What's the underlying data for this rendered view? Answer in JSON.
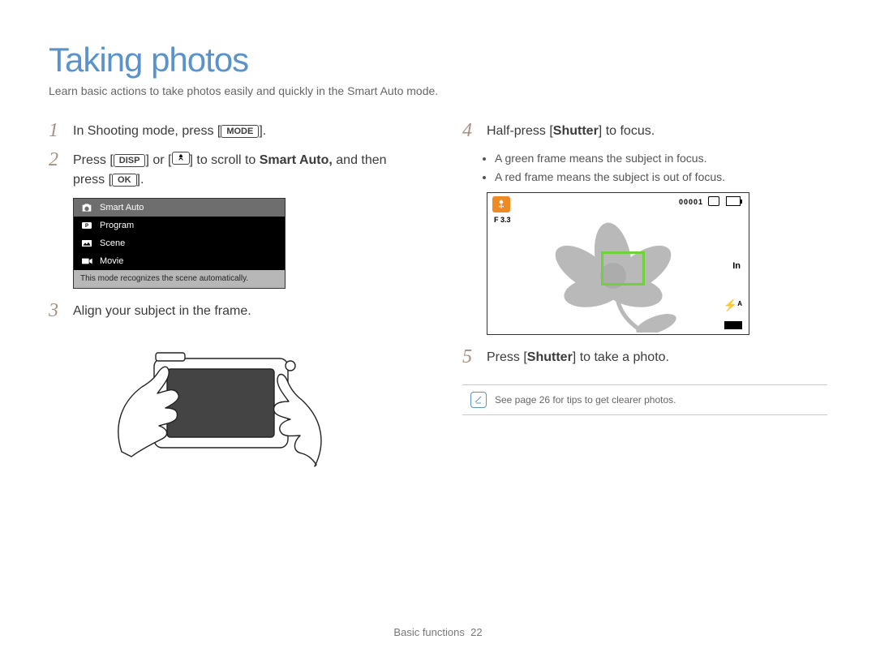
{
  "title": "Taking photos",
  "subtitle": "Learn basic actions to take photos easily and quickly in the Smart Auto mode.",
  "buttons": {
    "mode": "MODE",
    "disp": "DISP",
    "ok": "OK"
  },
  "steps": {
    "s1": {
      "num": "1",
      "pre": "In Shooting mode, press [",
      "post": "]."
    },
    "s2": {
      "num": "2",
      "pre": "Press [",
      "mid1": "] or [",
      "mid2": "] to scroll to ",
      "bold": "Smart Auto,",
      "tail": " and then press [",
      "post": "]."
    },
    "s3": {
      "num": "3",
      "text": "Align your subject in the frame."
    },
    "s4": {
      "num": "4",
      "pre": "Half-press [",
      "bold": "Shutter",
      "post": "] to focus."
    },
    "s4a": "A green frame means the subject in focus.",
    "s4b": "A red frame means the subject is out of focus.",
    "s5": {
      "num": "5",
      "pre": "Press [",
      "bold": "Shutter",
      "post": "] to take a photo."
    }
  },
  "modeMenu": {
    "items": [
      "Smart Auto",
      "Program",
      "Scene",
      "Movie"
    ],
    "caption": "This mode recognizes the scene automatically."
  },
  "lcd": {
    "aperture": "F 3.3",
    "shots": "00001",
    "flag": "In",
    "flashA": "A"
  },
  "tip": "See page 26 for tips to get clearer photos.",
  "footer": {
    "section": "Basic functions",
    "page": "22"
  }
}
